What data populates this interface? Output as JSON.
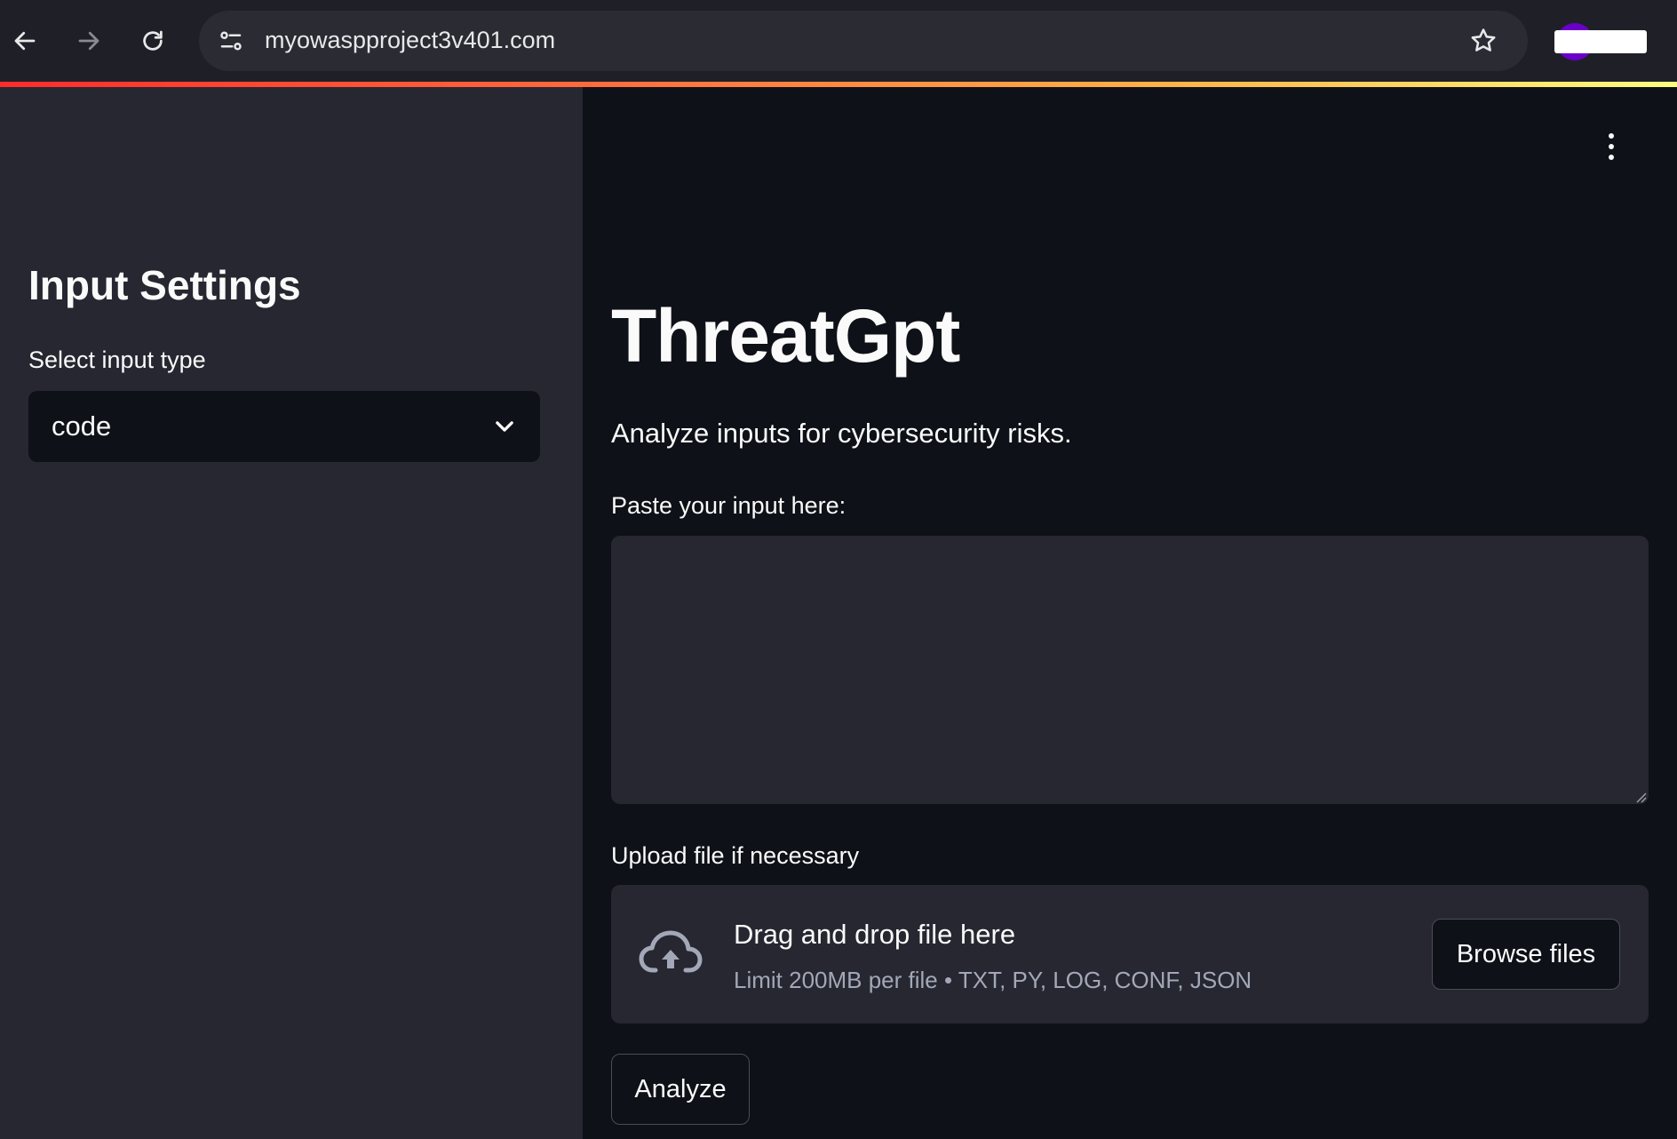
{
  "browser": {
    "url": "myowaspproject3v401.com",
    "icons": {
      "back": "arrow-left-icon",
      "forward": "arrow-right-icon",
      "reload": "reload-icon",
      "site_info": "tune-icon",
      "bookmark": "star-outline-icon",
      "profile": "avatar"
    },
    "accent_gradient": [
      "#ff2b2b",
      "#ff6a3d",
      "#ffb347",
      "#fffd80"
    ]
  },
  "sidebar": {
    "title": "Input Settings",
    "select_label": "Select input type",
    "select_value": "code",
    "background": "#262730"
  },
  "main": {
    "menu_icon": "kebab-menu-icon",
    "title": "ThreatGpt",
    "subtitle": "Analyze inputs for cybersecurity risks.",
    "input_label": "Paste your input here:",
    "input_value": "",
    "upload": {
      "label": "Upload file if necessary",
      "dropzone_title": "Drag and drop file here",
      "dropzone_limit": "Limit 200MB per file • TXT, PY, LOG, CONF, JSON",
      "browse_label": "Browse files",
      "icon": "cloud-upload-icon"
    },
    "analyze_label": "Analyze",
    "background": "#0e1117"
  }
}
